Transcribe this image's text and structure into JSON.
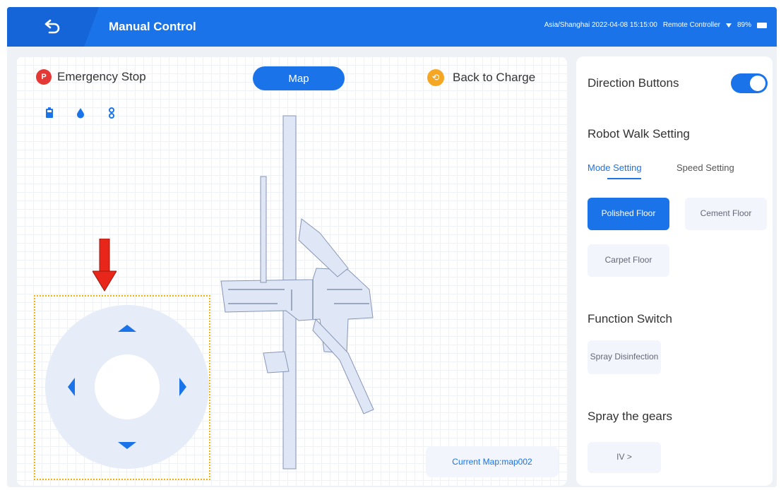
{
  "header": {
    "title": "Manual Control",
    "timezone_datetime": "Asia/Shanghai 2022-04-08 15:15:00",
    "controller": "Remote Controller",
    "battery": "89%"
  },
  "left": {
    "emergency_stop": {
      "icon_letter": "P",
      "label": "Emergency Stop"
    },
    "map_button": "Map",
    "back_to_charge": "Back to Charge",
    "status_icons": [
      "battery-icon",
      "water-drop-icon",
      "link-icon"
    ],
    "current_map": "Current Map:map002"
  },
  "right": {
    "direction_buttons": {
      "label": "Direction Buttons",
      "enabled": true
    },
    "robot_walk_setting": "Robot Walk Setting",
    "tabs": [
      {
        "label": "Mode Setting",
        "active": true
      },
      {
        "label": "Speed Setting",
        "active": false
      }
    ],
    "floor_modes": [
      {
        "label": "Polished Floor",
        "selected": true
      },
      {
        "label": "Cement Floor",
        "selected": false
      },
      {
        "label": "Carpet Floor",
        "selected": false
      }
    ],
    "function_switch": "Function Switch",
    "functions": [
      {
        "label": "Spray Disinfection",
        "selected": false
      }
    ],
    "spray_gears": "Spray the gears",
    "gear_value": "IV >"
  },
  "colors": {
    "primary": "#1a73e8",
    "emergency": "#e53935",
    "charge": "#f5a623",
    "highlight_box": "#f5b400",
    "annotation_arrow": "#e8261a"
  }
}
